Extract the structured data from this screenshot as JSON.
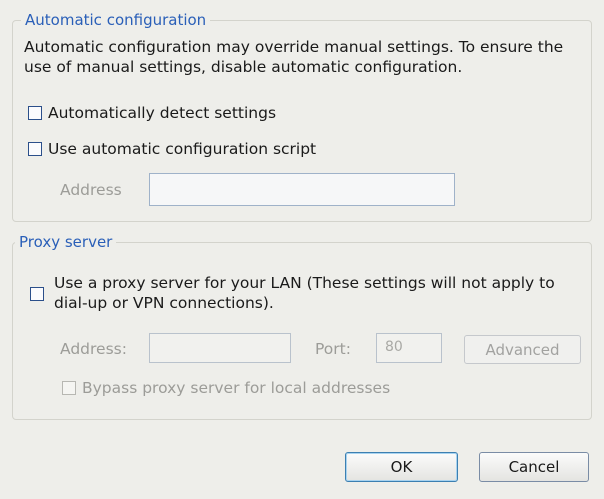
{
  "auto_config": {
    "legend": "Automatic configuration",
    "description": "Automatic configuration may override manual settings.  To ensure the use of manual settings, disable automatic configuration.",
    "detect_label": "Automatically detect settings",
    "detect_checked": false,
    "script_label": "Use automatic configuration script",
    "script_checked": false,
    "address_label": "Address",
    "address_value": ""
  },
  "proxy": {
    "legend": "Proxy server",
    "use_proxy_label": "Use a proxy server for your LAN (These settings will not apply to dial-up or VPN connections).",
    "use_proxy_checked": false,
    "address_label": "Address:",
    "address_value": "",
    "port_label": "Port:",
    "port_value": "80",
    "advanced_label": "Advanced",
    "bypass_label": "Bypass proxy server for local addresses",
    "bypass_checked": false
  },
  "buttons": {
    "ok": "OK",
    "cancel": "Cancel"
  }
}
